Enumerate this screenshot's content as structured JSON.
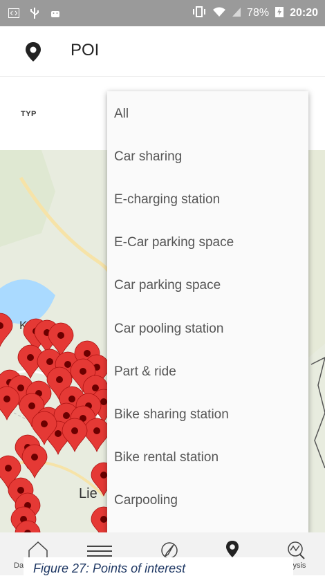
{
  "status_bar": {
    "battery_percent": "78%",
    "time": "20:20",
    "icons": [
      "code-icon",
      "usb-icon",
      "android-icon",
      "vibrate-icon",
      "wifi-icon",
      "signal-icon",
      "battery-charging-icon"
    ]
  },
  "app_bar": {
    "icon": "location-pin-icon",
    "title": "POI"
  },
  "filter": {
    "label": "TYP"
  },
  "dropdown": {
    "items": [
      "All",
      "Car sharing",
      "E-charging station",
      "E-Car parking space",
      "Car parking space",
      "Car pooling station",
      "Part & ride",
      "Bike sharing station",
      "Bike rental station",
      "Carpooling"
    ]
  },
  "map": {
    "labels": [
      "Ko",
      "Lie"
    ],
    "marker_color": "#e53935"
  },
  "bottom_nav": {
    "left_label": "Das",
    "right_label": "lysis",
    "icons": [
      "home-icon",
      "lanes-icon",
      "compass-icon",
      "location-pin-icon",
      "analysis-icon"
    ]
  },
  "caption": "Figure 27: Points of interest"
}
